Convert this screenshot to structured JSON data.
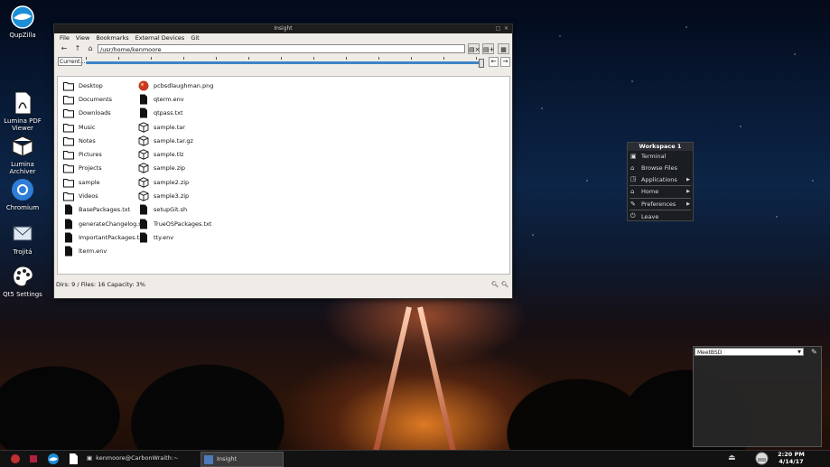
{
  "desktop": {
    "icons": [
      {
        "label": "QupZilla",
        "icon": "qupzilla-globe-icon"
      },
      {
        "label": "Lumina PDF Viewer",
        "icon": "pdf-icon"
      },
      {
        "label": "Lumina Archiver",
        "icon": "archive-box-icon"
      },
      {
        "label": "Chromium",
        "icon": "chromium-icon"
      },
      {
        "label": "Trojitá",
        "icon": "mail-icon"
      },
      {
        "label": "Qt5 Settings",
        "icon": "palette-icon"
      }
    ]
  },
  "window": {
    "title": "Insight",
    "menu": [
      "File",
      "View",
      "Bookmarks",
      "External Devices",
      "Git"
    ],
    "path": "/usr/home/kenmoore",
    "current_tab": "Current...",
    "status": "Dirs: 9 / Files: 16 Capacity: 3%",
    "files_col1": [
      {
        "name": "Desktop",
        "type": "folder"
      },
      {
        "name": "Documents",
        "type": "folder"
      },
      {
        "name": "Downloads",
        "type": "folder"
      },
      {
        "name": "Music",
        "type": "folder"
      },
      {
        "name": "Notes",
        "type": "folder"
      },
      {
        "name": "Pictures",
        "type": "folder"
      },
      {
        "name": "Projects",
        "type": "folder"
      },
      {
        "name": "sample",
        "type": "folder"
      },
      {
        "name": "Videos",
        "type": "folder"
      },
      {
        "name": "BasePackages.txt",
        "type": "file"
      },
      {
        "name": "generateChangelog.sh",
        "type": "file"
      },
      {
        "name": "ImportantPackages.txt",
        "type": "file"
      },
      {
        "name": "lterm.env",
        "type": "file"
      }
    ],
    "files_col2": [
      {
        "name": "pcbsdlaughman.png",
        "type": "image"
      },
      {
        "name": "qterm.env",
        "type": "file"
      },
      {
        "name": "qtpass.txt",
        "type": "file"
      },
      {
        "name": "sample.tar",
        "type": "archive"
      },
      {
        "name": "sample.tar.gz",
        "type": "archive"
      },
      {
        "name": "sample.tlz",
        "type": "archive"
      },
      {
        "name": "sample.zip",
        "type": "archive"
      },
      {
        "name": "sample2.zip",
        "type": "archive"
      },
      {
        "name": "sample3.zip",
        "type": "archive"
      },
      {
        "name": "setupGit.sh",
        "type": "file"
      },
      {
        "name": "TrueOSPackages.txt",
        "type": "file"
      },
      {
        "name": "tty.env",
        "type": "file"
      }
    ]
  },
  "workspace_menu": {
    "title": "Workspace 1",
    "items": [
      {
        "label": "Terminal",
        "icon": "terminal-icon",
        "submenu": false
      },
      {
        "label": "Browse Files",
        "icon": "home-icon",
        "submenu": false
      },
      {
        "label": "Applications",
        "icon": "applications-icon",
        "submenu": true
      },
      {
        "label": "Home",
        "icon": "home-icon",
        "submenu": true
      },
      {
        "label": "Preferences",
        "icon": "wrench-icon",
        "submenu": true
      },
      {
        "label": "Leave",
        "icon": "power-icon",
        "submenu": false
      }
    ]
  },
  "widget": {
    "selected": "MeetBSD"
  },
  "taskbar": {
    "tasks": [
      {
        "label": "kenmoore@CarbonWraith:~",
        "active": false
      },
      {
        "label": "Insight",
        "active": true
      }
    ],
    "clock_time": "2:20 PM",
    "clock_date": "4/14/17"
  },
  "colors": {
    "accent": "#3c85c6",
    "panel": "#1a1d22"
  }
}
